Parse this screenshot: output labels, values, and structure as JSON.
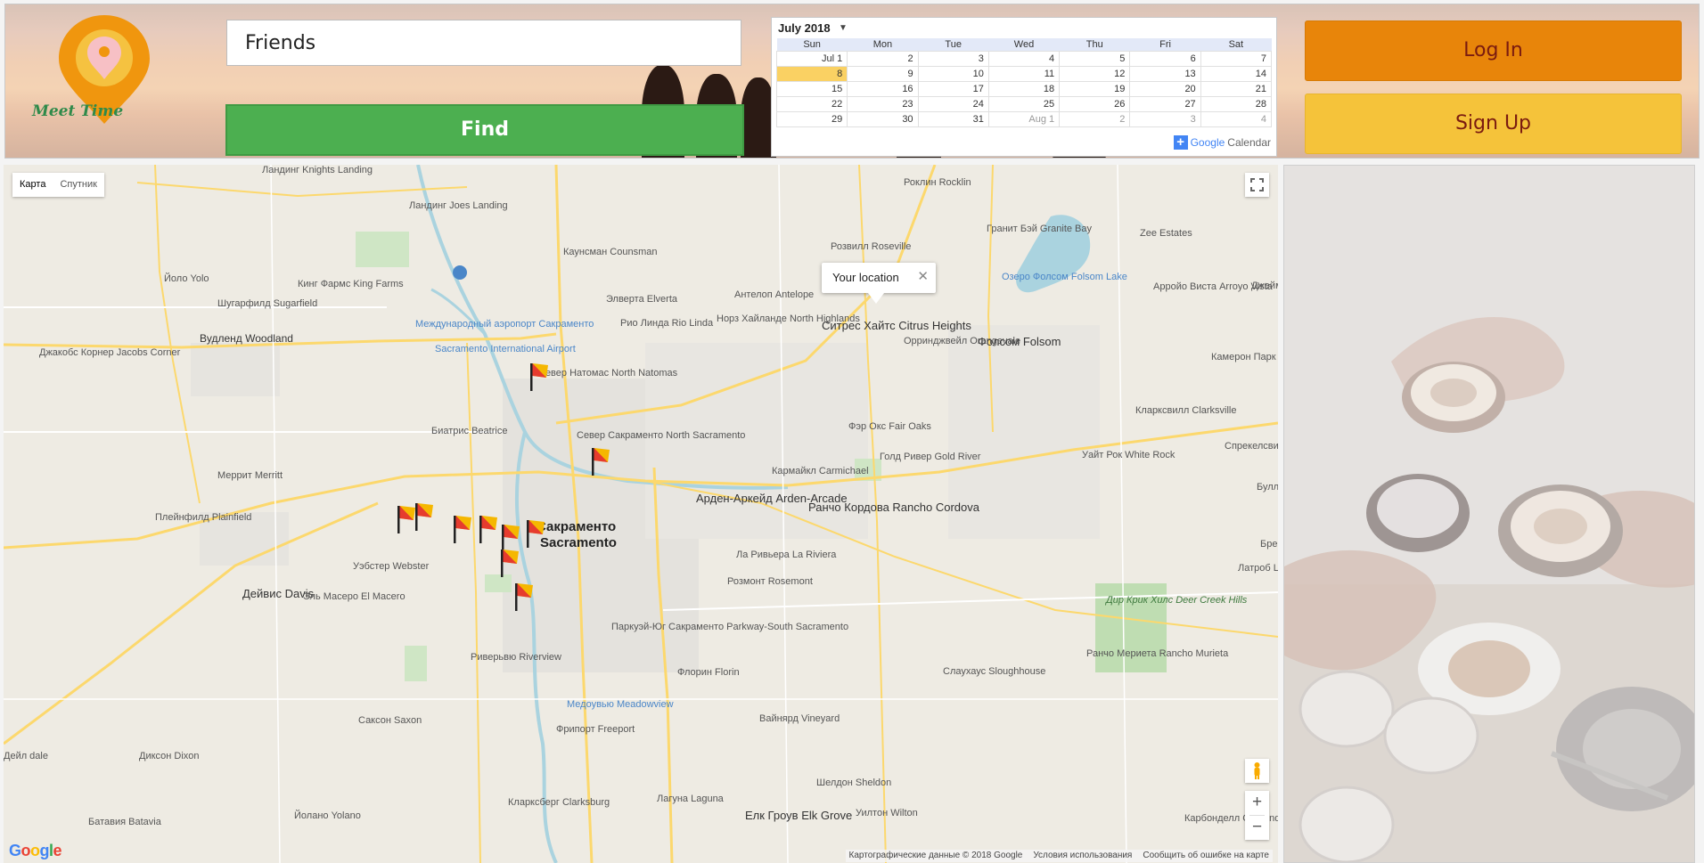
{
  "app": {
    "logo_text": "Meet Time",
    "colors": {
      "logo_orange": "#f0960e",
      "logo_yellow": "#f5c240",
      "logo_pin": "#f7c0c5",
      "brand_green": "#2f8a4a"
    }
  },
  "search": {
    "value": "Friends",
    "find_label": "Find",
    "find_color": "#4caf50"
  },
  "calendar": {
    "month_label": "July 2018",
    "dropdown_icon": "triangle-down-icon",
    "weekdays": [
      "Sun",
      "Mon",
      "Tue",
      "Wed",
      "Thu",
      "Fri",
      "Sat"
    ],
    "weeks": [
      [
        "Jul 1",
        "2",
        "3",
        "4",
        "5",
        "6",
        "7"
      ],
      [
        "8",
        "9",
        "10",
        "11",
        "12",
        "13",
        "14"
      ],
      [
        "15",
        "16",
        "17",
        "18",
        "19",
        "20",
        "21"
      ],
      [
        "22",
        "23",
        "24",
        "25",
        "26",
        "27",
        "28"
      ],
      [
        "29",
        "30",
        "31",
        "Aug 1",
        "2",
        "3",
        "4"
      ]
    ],
    "today": "8",
    "brand_plus": "+",
    "brand_google": "Google",
    "brand_calendar": "Calendar"
  },
  "auth": {
    "login_label": "Log In",
    "signup_label": "Sign Up",
    "login_color": "#e8850a",
    "signup_color": "#f5c33a"
  },
  "map": {
    "type_map": "Карта",
    "type_satellite": "Спутник",
    "infowindow_text": "Your location",
    "infowindow_close": "✕",
    "zoom_in": "+",
    "zoom_out": "−",
    "google_logo": "Google",
    "footer": {
      "data": "Картографические данные © 2018 Google",
      "terms": "Условия использования",
      "report": "Сообщить об ошибке на карте"
    },
    "labels": [
      "Ландинг Knights Landing",
      "Роклин Rocklin",
      "Гранит Бэй Granite Bay",
      "Zee Estates",
      "Ландинг Joes Landing",
      "Каунсман Counsman",
      "Розвилл Roseville",
      "Йоло Yolo",
      "Кинг Фармс King Farms",
      "Шугарфилд Sugarfield",
      "Озеро Фолсом Folsom Lake",
      "Арройо Виста Arroyo Vista",
      "Элверта Elverta",
      "Антелоп Antelope",
      "Ситрес Хайтс Citrus Heights",
      "Международный аэропорт Сакраменто",
      "Sacramento International Airport",
      "Рио Линда Rio Linda",
      "Норз Хайланде North Highlands",
      "Вудленд Woodland",
      "Джакобс Корнер Jacobs Corner",
      "Фолсом Folsom",
      "Орринджвейл Orangevale",
      "Камерон Парк Cameron Park",
      "Север Натомас North Natomas",
      "Север Сакраменто North Sacramento",
      "Биатрис Beatrice",
      "Фэр Окс Fair Oaks",
      "Кларксвилл Clarksville",
      "Спрекелсвилл Sprekelsville",
      "Голд Ривер Gold River",
      "Уайт Рок White Rock",
      "Меррит Merritt",
      "Кармайкл Carmichael",
      "Арден-Аркейд Arden-Arcade",
      "Плейнфилд Plainfield",
      "Ранчо Кордова Rancho Cordova",
      "Сакраменто",
      "Sacramento",
      "Уэбстер Webster",
      "Ла Ривьера La Riviera",
      "Латроб Latrobe",
      "Дейвис Davis",
      "Эль Масеро El Macero",
      "Розмонт Rosemont",
      "Дир Крик Хилс Deer Creek Hills",
      "Паркуэй-Юг Сакраменто Parkway-South Sacramento",
      "Риверьвю Riverview",
      "Флорин Florin",
      "Слаухаус Sloughhouse",
      "Ранчо Мериета Rancho Murieta",
      "Саксон Saxon",
      "Фрипорт Freeport",
      "Вайнярд Vineyard",
      "Диксон Dixon",
      "Шелдон Sheldon",
      "Кларксберг Clarksburg",
      "Лагуна Laguna",
      "Елк Гроув Elk Grove",
      "Уилтон Wilton",
      "Карбонделл Carbondale",
      "Батавия Batavia",
      "Йолано Yolano",
      "Медоувью Meadowview",
      "Булл Bull",
      "Бре Bre",
      "Джейм Jayh",
      "Дейл dale"
    ],
    "markers_count": 10
  },
  "side_photo": {
    "description_icon": "coffee-photo"
  }
}
